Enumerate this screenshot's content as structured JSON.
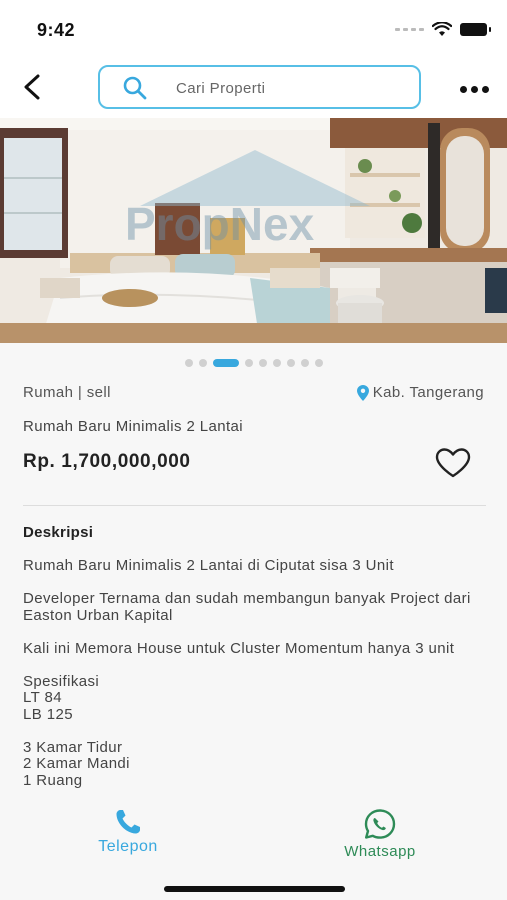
{
  "status_bar": {
    "time": "9:42"
  },
  "header": {
    "search": {
      "placeholder": "Cari Properti",
      "value": ""
    },
    "icons": [
      "back-arrow-icon",
      "search-icon",
      "more-horizontal-icon"
    ]
  },
  "hero": {
    "watermark": "PropNex",
    "slide_count": 9,
    "active_slide": 3
  },
  "listing": {
    "type": "Rumah | sell",
    "location": "Kab. Tangerang",
    "title": "Rumah Baru Minimalis 2 Lantai",
    "price": "Rp. 1,700,000,000",
    "favorited": false
  },
  "description": {
    "heading": "Deskripsi",
    "paragraphs": [
      "Rumah Baru Minimalis 2 Lantai di Ciputat sisa 3 Unit",
      "Developer Ternama dan sudah membangun banyak Project dari Easton Urban Kapital",
      "Kali ini Memora House untuk Cluster Momentum hanya 3 unit",
      "Spesifikasi\nLT 84\nLB 125",
      "3 Kamar Tidur\n2 Kamar Mandi\n1 Ruang"
    ]
  },
  "actions": {
    "telepon_label": "Telepon",
    "whatsapp_label": "Whatsapp"
  },
  "colors": {
    "accent": "#38a8de",
    "search_border": "#57bfe6",
    "whatsapp": "#2e8b57",
    "background": "#f7f7f7"
  }
}
